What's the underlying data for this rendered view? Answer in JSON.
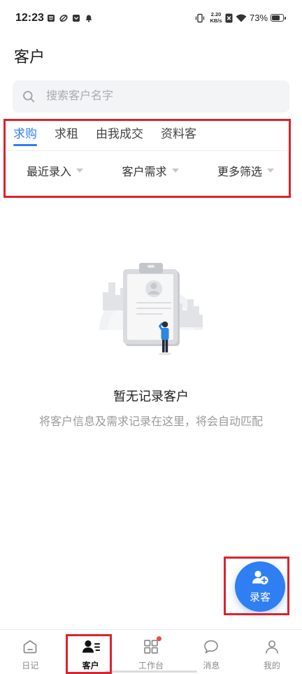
{
  "status_bar": {
    "time": "12:23",
    "left_icons": [
      "tray-notification-icon",
      "oval-app-icon",
      "message-box-icon",
      "bell-icon"
    ],
    "net_speed": {
      "value": "2.20",
      "unit": "KB/s"
    },
    "right_icons": [
      "vibrate-icon",
      "no-sim-icon",
      "wifi-icon",
      "battery-icon"
    ],
    "battery": "73%",
    "battery_level": 0.73
  },
  "header": {
    "title": "客户"
  },
  "search": {
    "placeholder": "搜索客户名字",
    "value": "",
    "icon": "search-icon"
  },
  "tabs": [
    {
      "label": "求购",
      "active": true
    },
    {
      "label": "求租",
      "active": false
    },
    {
      "label": "由我成交",
      "active": false
    },
    {
      "label": "资料客",
      "active": false
    }
  ],
  "filters": [
    {
      "label": "最近录入",
      "icon": "caret-down-icon"
    },
    {
      "label": "客户需求",
      "icon": "caret-down-icon"
    },
    {
      "label": "更多筛选",
      "icon": "caret-down-icon"
    }
  ],
  "empty_state": {
    "illustration_icon": "empty-clipboard-illustration",
    "title": "暂无记录客户",
    "description": "将客户信息及需求记录在这里，将会自动匹配"
  },
  "fab": {
    "label": "录客",
    "icon": "add-customer-icon"
  },
  "bottom_nav": [
    {
      "label": "日记",
      "icon": "diary-home-icon",
      "active": false,
      "badge": false
    },
    {
      "label": "客户",
      "icon": "customer-list-icon",
      "active": true,
      "badge": false
    },
    {
      "label": "工作台",
      "icon": "workbench-grid-icon",
      "active": false,
      "badge": true
    },
    {
      "label": "消息",
      "icon": "message-chat-icon",
      "active": false,
      "badge": false
    },
    {
      "label": "我的",
      "icon": "profile-icon",
      "active": false,
      "badge": false
    }
  ],
  "colors": {
    "accent": "#2f7ff3",
    "text": "#222222",
    "muted": "#9a9a9a",
    "badge": "#f2494b",
    "highlight": "#d9232d"
  }
}
